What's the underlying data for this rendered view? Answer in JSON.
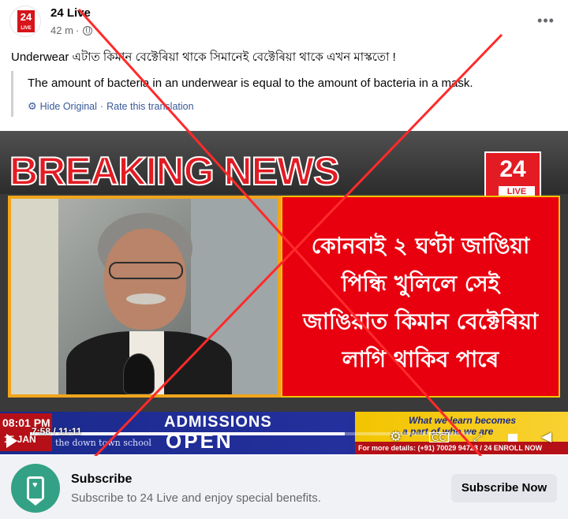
{
  "post": {
    "page_name": "24 Live",
    "timestamp": "42 m",
    "separator": "·",
    "avatar_logo_text": "24",
    "avatar_logo_sub": "LIVE",
    "more_icon": "ellipsis-icon",
    "text": "Underwear এটাত কিমান বেক্টেৰিয়া থাকে সিমানেই বেক্টেৰিয়া থাকে এখন মাস্কতো !",
    "translation": "The amount of bacteria in an underwear is equal to the amount of bacteria in a mask.",
    "hide_original": "Hide Original",
    "link_separator": "·",
    "rate_translation": "Rate this translation"
  },
  "video": {
    "headline": "BREAKING NEWS",
    "channel_logo_num": "24 24",
    "channel_logo_live": "LIVE",
    "panel_lines": [
      "কোনবাই ২ ঘণ্টা জাঙিয়া",
      "পিন্ধি খুলিলে সেই",
      "জাঙিয়াত কিমান বেক্টেৰিয়া",
      "লাগি থাকিব পাৰে"
    ],
    "ticker": {
      "time": "08:01 PM",
      "date": "15 JAN",
      "admissions": "ADMISSIONS",
      "open": "OPEN",
      "school": "the down town school",
      "promo_line1": "What we learn becomes",
      "promo_line2": "a part of who we are",
      "promo_details": "For more details: (+91) 70029 94723 / 24 ENROLL NOW"
    },
    "player": {
      "current": "7:58",
      "duration": "11:11",
      "time_separator": " / ",
      "progress": 0.712
    }
  },
  "subscribe": {
    "title": "Subscribe",
    "description": "Subscribe to 24 Live and enjoy special benefits.",
    "button": "Subscribe Now"
  },
  "colors": {
    "accent_red": "#e31b23",
    "link_blue": "#385898",
    "subscribe_green": "#33a185",
    "ticker_blue": "#1b2a8c",
    "promo_yellow": "#f2c400",
    "x_mark_red": "#ff2a2a"
  }
}
